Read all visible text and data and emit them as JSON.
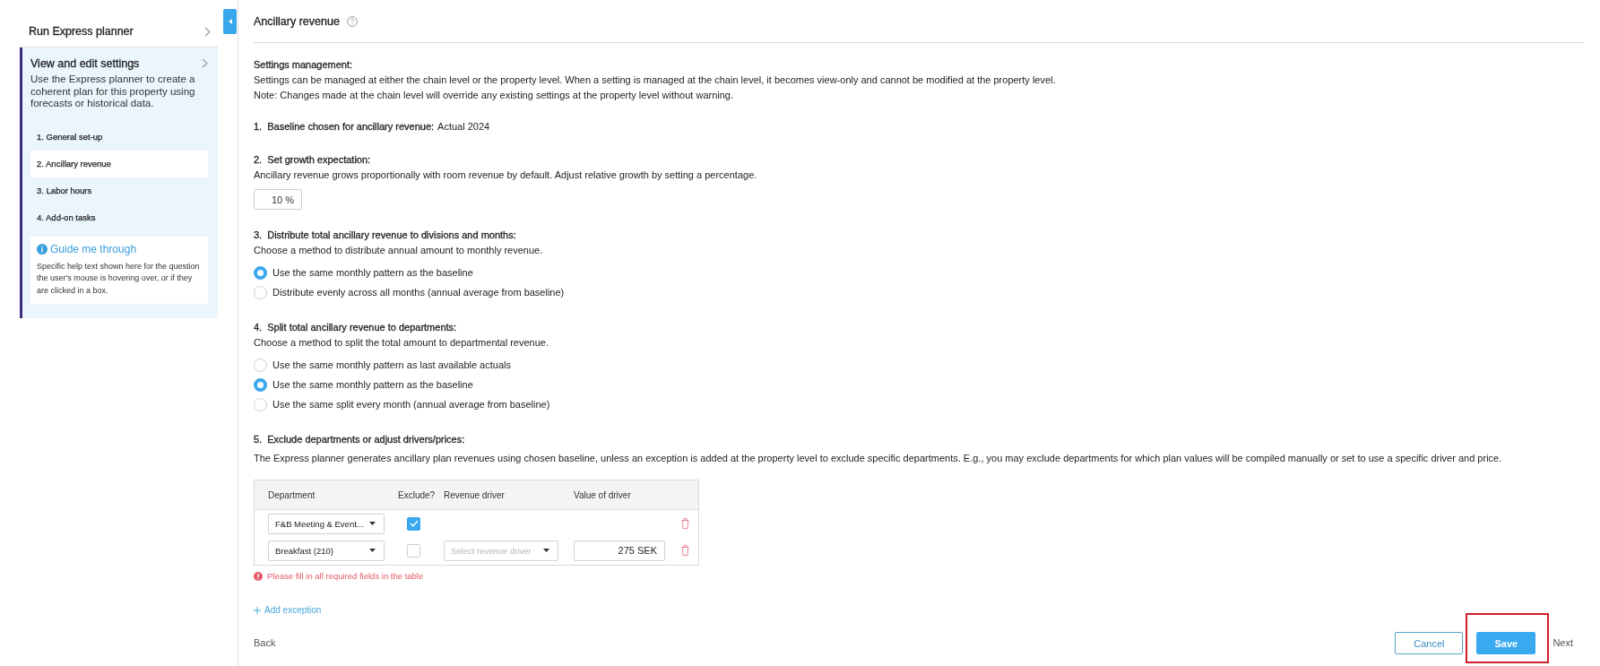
{
  "sidebar": {
    "run_item": {
      "label": "Run Express planner"
    },
    "panel": {
      "title": "View and edit settings",
      "description": "Use the Express planner to create a coherent plan for this property using forecasts or historical data.",
      "steps": [
        {
          "label": "1. General set-up",
          "selected": false
        },
        {
          "label": "2. Ancillary revenue",
          "selected": true
        },
        {
          "label": "3. Labor hours",
          "selected": false
        },
        {
          "label": "4. Add-on tasks",
          "selected": false
        }
      ],
      "guide": {
        "title": "Guide me through",
        "text": "Specific help text shown here for the question the user's mouse is hovering over, or if they are clicked in a box."
      }
    }
  },
  "page": {
    "title": "Ancillary revenue"
  },
  "settings_management": {
    "heading": "Settings management:",
    "lines": [
      "Settings can be managed at either the chain level or the property level. When a setting is managed at the chain level, it becomes view-only and cannot be modified at the property level.",
      "Note: Changes made at the chain level will override any existing settings at the property level without warning."
    ]
  },
  "sections": [
    {
      "kind": "value",
      "number": "1.",
      "heading": "Baseline chosen for ancillary revenue:",
      "value": "Actual 2024"
    },
    {
      "kind": "input",
      "number": "2.",
      "heading": "Set growth expectation:",
      "description": "Ancillary revenue grows proportionally with room revenue by default. Adjust relative growth by setting a percentage.",
      "input": {
        "value": "10 %"
      }
    },
    {
      "kind": "radio",
      "number": "3.",
      "heading": "Distribute total ancillary revenue to divisions and months:",
      "description": "Choose a method to distribute annual amount to monthly revenue.",
      "options": [
        {
          "label": "Use the same monthly pattern as the baseline",
          "selected": true
        },
        {
          "label": "Distribute evenly across all months (annual average from baseline)",
          "selected": false
        }
      ]
    },
    {
      "kind": "radio",
      "number": "4.",
      "heading": "Split total ancillary revenue to departments:",
      "description": "Choose a method to split the total amount to departmental revenue.",
      "options": [
        {
          "label": "Use the same monthly pattern as last available actuals",
          "selected": false
        },
        {
          "label": "Use the same monthly pattern as the baseline",
          "selected": true
        },
        {
          "label": "Use the same split every month (annual average from baseline)",
          "selected": false
        }
      ]
    },
    {
      "kind": "table",
      "number": "5.",
      "heading": "Exclude departments or adjust drivers/prices:",
      "description": "The Express planner generates ancillary plan revenues using chosen baseline, unless an exception is added at the property level to exclude specific departments. E.g., you may exclude departments for which plan values will be compiled manually or set to use a specific driver and price.",
      "table": {
        "columns": [
          "Department",
          "Exclude?",
          "Revenue driver",
          "Value of driver"
        ],
        "rows": [
          {
            "department": "F&B Meeting & Event...",
            "excluded": true
          },
          {
            "department": "Breakfast (210)",
            "excluded": false,
            "driver": {
              "placeholder": "Select revenue driver"
            },
            "value": "275 SEK"
          }
        ]
      },
      "error": "Please fill in all required fields in the table",
      "add_link": "Add exception"
    }
  ],
  "footer": {
    "back": "Back",
    "buttons": [
      {
        "label": "Cancel",
        "kind": "secondary",
        "highlighted": false
      },
      {
        "label": "Save",
        "kind": "primary",
        "highlighted": true
      }
    ],
    "next": "Next"
  }
}
